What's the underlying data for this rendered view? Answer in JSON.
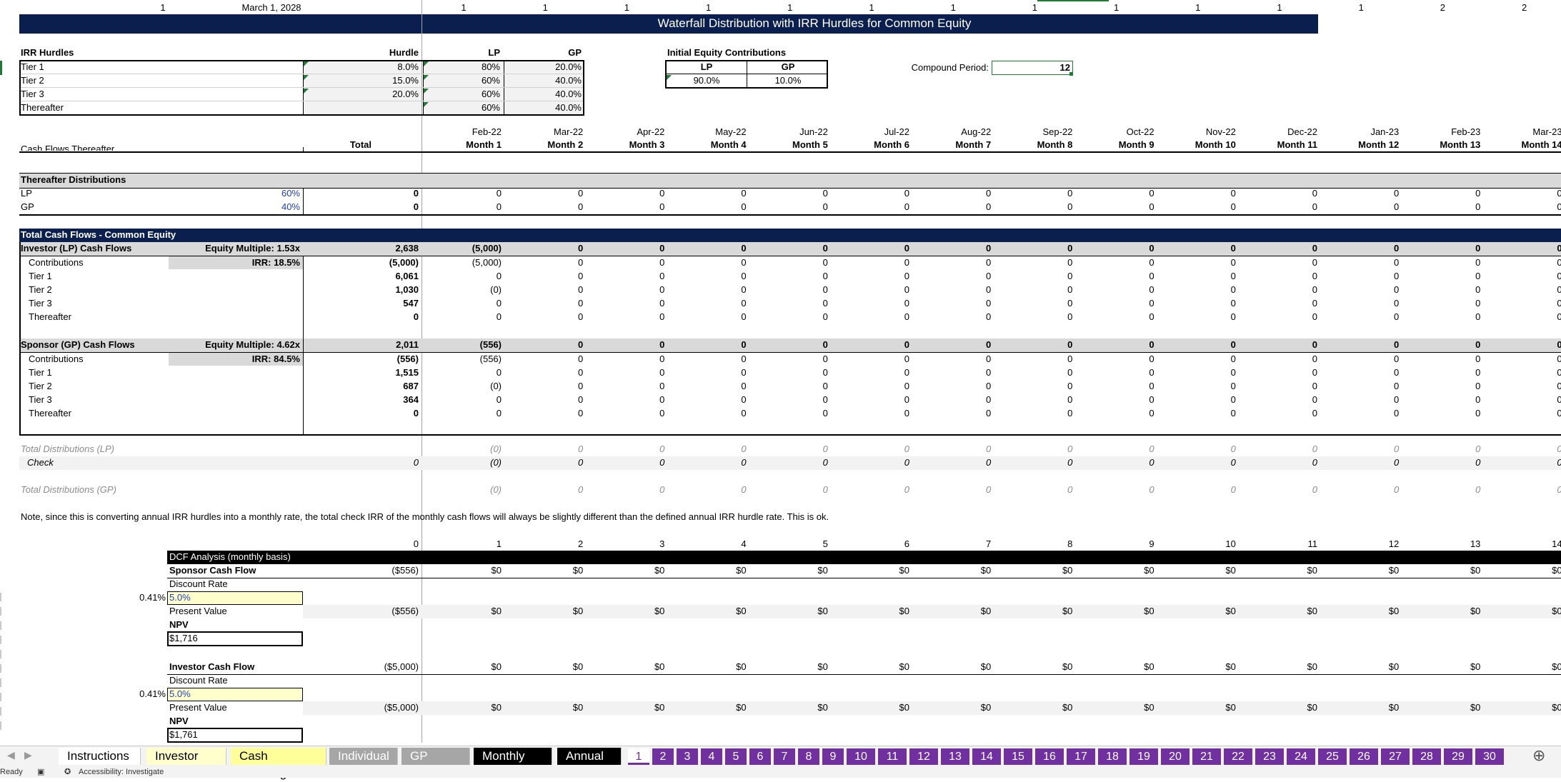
{
  "top_row": {
    "left_cells": [
      "1",
      "March 1, 2028"
    ],
    "month_flags": [
      "1",
      "1",
      "1",
      "1",
      "1",
      "1",
      "1",
      "1",
      "1",
      "1",
      "1",
      "1",
      "2",
      "2"
    ]
  },
  "title": "Waterfall Distribution with IRR Hurdles for Common Equity",
  "irr_hurdles": {
    "heading": "IRR Hurdles",
    "col_hurdle": "Hurdle",
    "col_lp": "LP",
    "col_gp": "GP",
    "rows": [
      {
        "label": "Tier 1",
        "hurdle": "8.0%",
        "lp": "80%",
        "gp": "20.0%"
      },
      {
        "label": "Tier 2",
        "hurdle": "15.0%",
        "lp": "60%",
        "gp": "40.0%"
      },
      {
        "label": "Tier 3",
        "hurdle": "20.0%",
        "lp": "60%",
        "gp": "40.0%"
      },
      {
        "label": "Thereafter",
        "hurdle": "",
        "lp": "60%",
        "gp": "40.0%"
      }
    ]
  },
  "initial_equity": {
    "heading": "Initial Equity Contributions",
    "col_lp": "LP",
    "col_gp": "GP",
    "lp_value": "90.0%",
    "gp_value": "10.0%"
  },
  "compound_period": {
    "label": "Compound Period:",
    "value": "12"
  },
  "timeline": {
    "total_label": "Total",
    "dates": [
      "Feb-22",
      "Mar-22",
      "Apr-22",
      "May-22",
      "Jun-22",
      "Jul-22",
      "Aug-22",
      "Sep-22",
      "Oct-22",
      "Nov-22",
      "Dec-22",
      "Jan-23",
      "Feb-23",
      "Mar-23"
    ],
    "months": [
      "Month 1",
      "Month 2",
      "Month 3",
      "Month 4",
      "Month 5",
      "Month 6",
      "Month 7",
      "Month 8",
      "Month 9",
      "Month 10",
      "Month 11",
      "Month 12",
      "Month 13",
      "Month 14"
    ]
  },
  "cut_label": "Cash Flows Thereafter",
  "thereafter_distributions": {
    "heading": "Thereafter Distributions",
    "rows": [
      {
        "label": "LP",
        "pct": "60%",
        "total": "0",
        "values": [
          "0",
          "0",
          "0",
          "0",
          "0",
          "0",
          "0",
          "0",
          "0",
          "0",
          "0",
          "0",
          "0",
          "0"
        ]
      },
      {
        "label": "GP",
        "pct": "40%",
        "total": "0",
        "values": [
          "0",
          "0",
          "0",
          "0",
          "0",
          "0",
          "0",
          "0",
          "0",
          "0",
          "0",
          "0",
          "0",
          "0"
        ]
      }
    ]
  },
  "total_cash_flows": {
    "heading": "Total Cash Flows - Common Equity",
    "lp": {
      "label": "Investor (LP) Cash Flows",
      "multiple": "Equity Multiple: 1.53x",
      "irr": "IRR: 18.5%",
      "total": "2,638",
      "values": [
        "(5,000)",
        "0",
        "0",
        "0",
        "0",
        "0",
        "0",
        "0",
        "0",
        "0",
        "0",
        "0",
        "0",
        "0"
      ],
      "rows": [
        {
          "label": "Contributions",
          "total": "(5,000)",
          "m1": "(5,000)"
        },
        {
          "label": "Tier 1",
          "total": "6,061",
          "m1": "0"
        },
        {
          "label": "Tier 2",
          "total": "1,030",
          "m1": "(0)"
        },
        {
          "label": "Tier 3",
          "total": "547",
          "m1": "0"
        },
        {
          "label": "Thereafter",
          "total": "0",
          "m1": "0"
        }
      ]
    },
    "gp": {
      "label": "Sponsor (GP) Cash Flows",
      "multiple": "Equity Multiple: 4.62x",
      "irr": "IRR: 84.5%",
      "total": "2,011",
      "values": [
        "(556)",
        "0",
        "0",
        "0",
        "0",
        "0",
        "0",
        "0",
        "0",
        "0",
        "0",
        "0",
        "0",
        "0"
      ],
      "rows": [
        {
          "label": "Contributions",
          "total": "(556)",
          "m1": "(556)"
        },
        {
          "label": "Tier 1",
          "total": "1,515",
          "m1": "0"
        },
        {
          "label": "Tier 2",
          "total": "687",
          "m1": "(0)"
        },
        {
          "label": "Tier 3",
          "total": "364",
          "m1": "0"
        },
        {
          "label": "Thereafter",
          "total": "0",
          "m1": "0"
        }
      ]
    },
    "zero": "0"
  },
  "checks": {
    "lp_label": "Total Distributions (LP)",
    "check_label": "Check",
    "check_total": "0",
    "gp_label": "Total Distributions (GP)",
    "m1": "(0)",
    "zero": "0"
  },
  "note": "Note, since this is converting annual IRR hurdles into a monthly rate, the total check IRR of the monthly cash flows will always be slightly different than the defined annual IRR hurdle rate. This is ok.",
  "dcf": {
    "periods": [
      "0",
      "1",
      "2",
      "3",
      "4",
      "5",
      "6",
      "7",
      "8",
      "9",
      "10",
      "11",
      "12",
      "13",
      "14"
    ],
    "heading": "DCF Analysis (monthly basis)",
    "sponsor": {
      "label": "Sponsor Cash Flow",
      "cf0": "($556)",
      "discount_label": "Discount Rate",
      "monthly_rate": "0.41%",
      "rate": "5.0%",
      "pv_label": "Present Value",
      "pv0": "($556)",
      "npv_label": "NPV",
      "npv": "$1,716"
    },
    "investor": {
      "label": "Investor Cash Flow",
      "cf0": "($5,000)",
      "discount_label": "Discount Rate",
      "monthly_rate": "0.41%",
      "rate": "5.0%",
      "pv_label": "Present Value",
      "pv0": "($5,000)",
      "npv_label": "NPV",
      "npv": "$1,761"
    },
    "zero": "$0"
  },
  "tabs": [
    {
      "label": "Instructions",
      "bg": "#ffffff",
      "fg": "#000000"
    },
    {
      "label": "Investor List",
      "bg": "#ffffcc",
      "fg": "#000000"
    },
    {
      "label": "Cash Planning",
      "bg": "#ffff99",
      "fg": "#000000"
    },
    {
      "label": "Individual",
      "bg": "#a6a6a6",
      "fg": "#ffffff"
    },
    {
      "label": "GP Totals",
      "bg": "#a6a6a6",
      "fg": "#ffffff"
    },
    {
      "label": "Monthly CF",
      "bg": "#000000",
      "fg": "#ffffff"
    },
    {
      "label": "Annual CF",
      "bg": "#000000",
      "fg": "#ffffff"
    }
  ],
  "number_tabs": [
    "1",
    "2",
    "3",
    "4",
    "5",
    "6",
    "7",
    "8",
    "9",
    "10",
    "11",
    "12",
    "13",
    "14",
    "15",
    "16",
    "17",
    "18",
    "19",
    "20",
    "21",
    "22",
    "23",
    "24",
    "25",
    "26",
    "27",
    "28",
    "29",
    "30"
  ],
  "active_number_tab": "1",
  "status": {
    "ready": "Ready",
    "accessibility": "Accessibility: Investigate"
  }
}
